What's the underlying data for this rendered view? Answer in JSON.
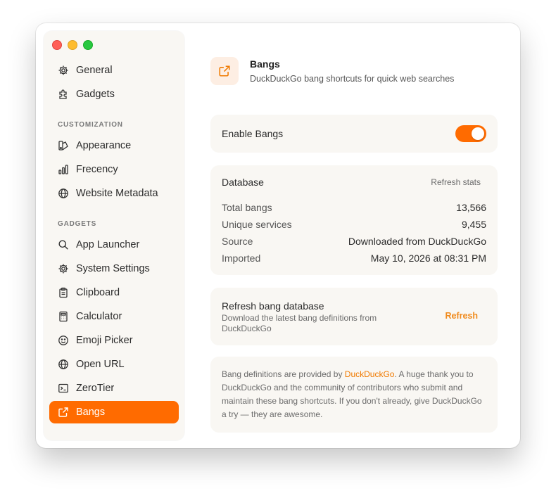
{
  "sidebar": {
    "items_top": [
      {
        "label": "General",
        "icon": "gear-icon"
      },
      {
        "label": "Gadgets",
        "icon": "puzzle-icon"
      }
    ],
    "customization_header": "CUSTOMIZATION",
    "customization_items": [
      {
        "label": "Appearance",
        "icon": "appearance-icon"
      },
      {
        "label": "Frecency",
        "icon": "bar-chart-icon"
      },
      {
        "label": "Website Metadata",
        "icon": "globe-icon"
      }
    ],
    "gadgets_header": "GADGETS",
    "gadget_items": [
      {
        "label": "App Launcher",
        "icon": "search-icon"
      },
      {
        "label": "System Settings",
        "icon": "gear-icon"
      },
      {
        "label": "Clipboard",
        "icon": "clipboard-icon"
      },
      {
        "label": "Calculator",
        "icon": "calculator-icon"
      },
      {
        "label": "Emoji Picker",
        "icon": "smiley-icon"
      },
      {
        "label": "Open URL",
        "icon": "globe-icon"
      },
      {
        "label": "ZeroTier",
        "icon": "terminal-icon"
      },
      {
        "label": "Bangs",
        "icon": "external-link-icon",
        "active": true
      }
    ]
  },
  "header": {
    "title": "Bangs",
    "subtitle": "DuckDuckGo bang shortcuts for quick web searches"
  },
  "toggle": {
    "label": "Enable Bangs",
    "enabled": true
  },
  "database": {
    "title": "Database",
    "refresh_stats_label": "Refresh stats",
    "rows": [
      {
        "key": "Total bangs",
        "value": "13,566"
      },
      {
        "key": "Unique services",
        "value": "9,455"
      },
      {
        "key": "Source",
        "value": "Downloaded from DuckDuckGo"
      },
      {
        "key": "Imported",
        "value": "May 10, 2026 at 08:31 PM"
      }
    ]
  },
  "refresh_card": {
    "title": "Refresh bang database",
    "description": "Download the latest bang definitions from DuckDuckGo",
    "button": "Refresh"
  },
  "credit": {
    "prefix": "Bang definitions are provided by ",
    "link": "DuckDuckGo",
    "suffix": ". A huge thank you to DuckDuckGo and the community of contributors who submit and maintain these bang shortcuts. If you don't already, give DuckDuckGo a try — they are awesome."
  },
  "colors": {
    "accent": "#ff6b00",
    "link": "#f07a00",
    "card_bg": "#f9f7f3"
  }
}
